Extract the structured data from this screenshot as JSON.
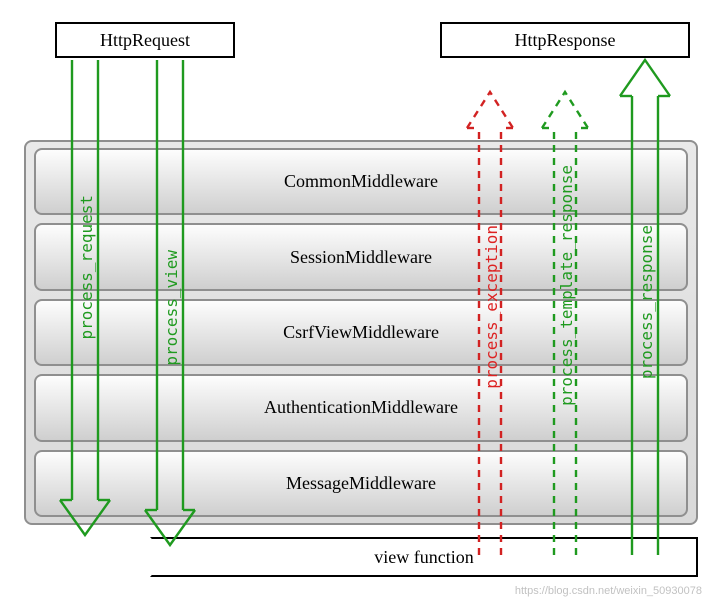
{
  "top": {
    "request": "HttpRequest",
    "response": "HttpResponse"
  },
  "middlewares": [
    "CommonMiddleware",
    "SessionMiddleware",
    "CsrfViewMiddleware",
    "AuthenticationMiddleware",
    "MessageMiddleware"
  ],
  "view_label": "view function",
  "arrows": {
    "process_request": "process_request",
    "process_view": "process_view",
    "process_exception": "process_exception",
    "process_template_response": "process_template_response",
    "process_response": "process_response"
  },
  "colors": {
    "green": "#1f9a1f",
    "red": "#d22222"
  },
  "watermark": "https://blog.csdn.net/weixin_50930078",
  "chart_data": {
    "type": "diagram",
    "title": "Django middleware request/response flow",
    "nodes": [
      {
        "id": "HttpRequest",
        "kind": "io"
      },
      {
        "id": "HttpResponse",
        "kind": "io"
      },
      {
        "id": "CommonMiddleware",
        "kind": "middleware",
        "order": 1
      },
      {
        "id": "SessionMiddleware",
        "kind": "middleware",
        "order": 2
      },
      {
        "id": "CsrfViewMiddleware",
        "kind": "middleware",
        "order": 3
      },
      {
        "id": "AuthenticationMiddleware",
        "kind": "middleware",
        "order": 4
      },
      {
        "id": "MessageMiddleware",
        "kind": "middleware",
        "order": 5
      },
      {
        "id": "view function",
        "kind": "view"
      }
    ],
    "flows": [
      {
        "name": "process_request",
        "from": "HttpRequest",
        "to": "view function",
        "direction": "down",
        "style": "solid",
        "color": "green"
      },
      {
        "name": "process_view",
        "from": "HttpRequest",
        "to": "view function",
        "direction": "down",
        "style": "solid",
        "color": "green"
      },
      {
        "name": "process_exception",
        "from": "view function",
        "to": "HttpResponse",
        "direction": "up",
        "style": "dashed",
        "color": "red"
      },
      {
        "name": "process_template_response",
        "from": "view function",
        "to": "HttpResponse",
        "direction": "up",
        "style": "dashed",
        "color": "green"
      },
      {
        "name": "process_response",
        "from": "view function",
        "to": "HttpResponse",
        "direction": "up",
        "style": "solid",
        "color": "green"
      }
    ]
  }
}
